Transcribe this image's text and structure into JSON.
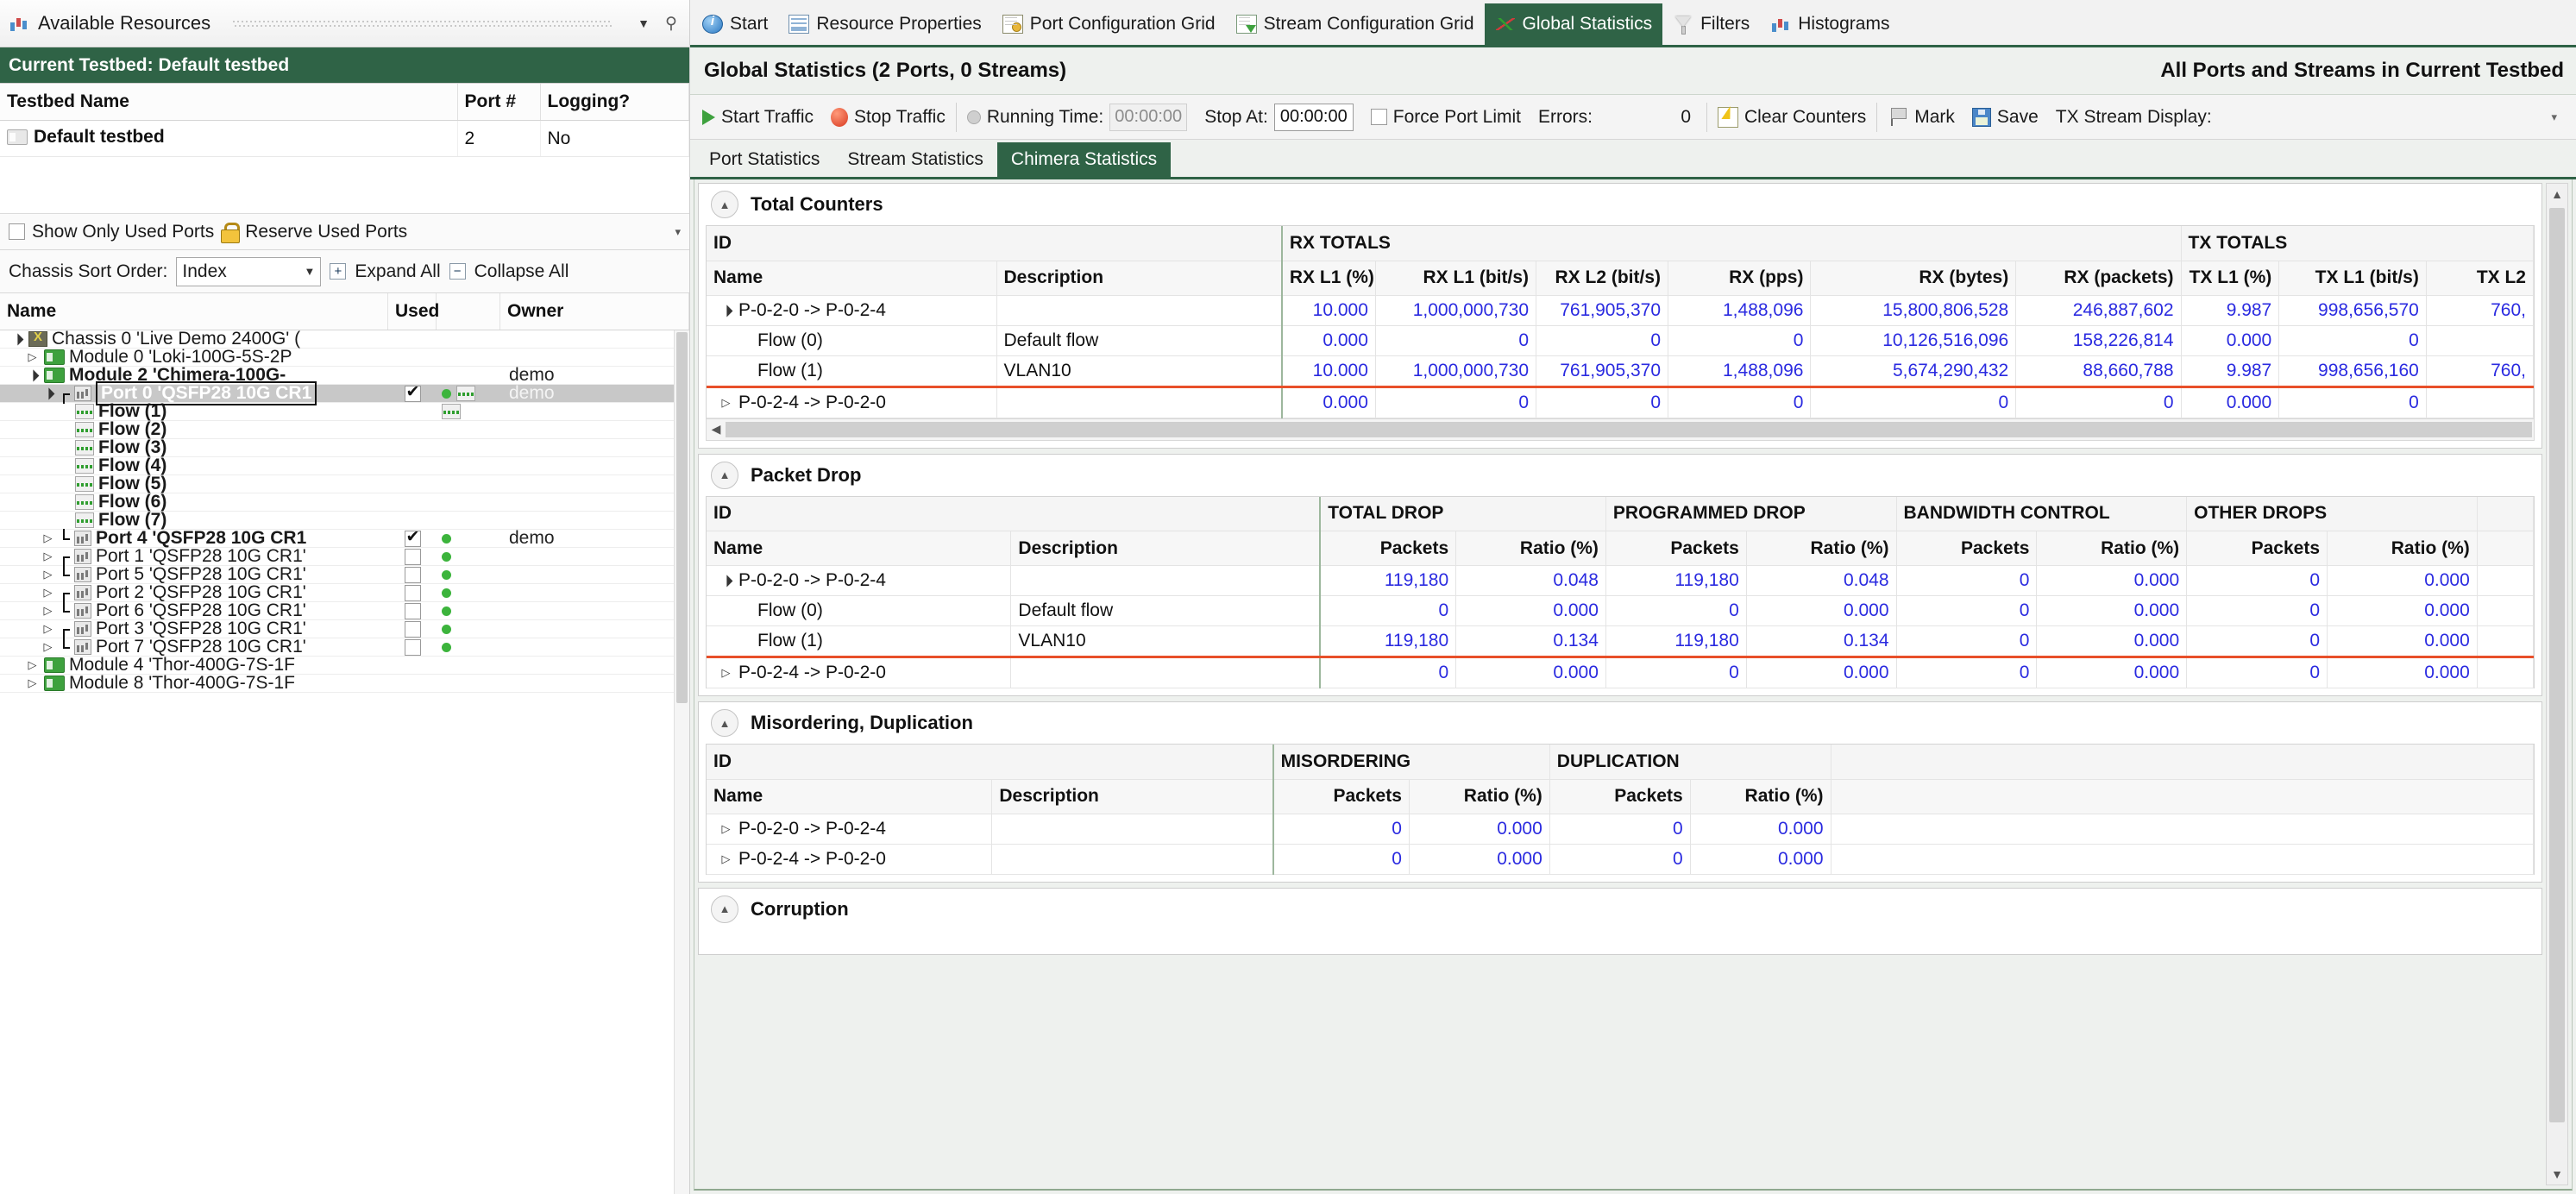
{
  "left_panel": {
    "title": "Available Resources",
    "title_icon": "chart-icon",
    "caret_icon": "chevron-down-icon",
    "pin_icon": "pin-icon",
    "testbed_banner": "Current Testbed: Default testbed",
    "testbed_table": {
      "headers": [
        "Testbed Name",
        "Port #",
        "Logging?"
      ],
      "rows": [
        {
          "name": "Default testbed",
          "ports": "2",
          "logging": "No"
        }
      ]
    },
    "options": {
      "show_only_used_ports": {
        "label": "Show Only Used Ports",
        "checked": false
      },
      "reserve_used_ports": {
        "label": "Reserve Used Ports"
      },
      "overflow_caret": "chevron-down-icon"
    },
    "sort_row": {
      "label": "Chassis Sort Order:",
      "value": "Index",
      "expand_all": "Expand All",
      "collapse_all": "Collapse All"
    },
    "tree_headers": [
      "Name",
      "Used",
      "",
      "Owner"
    ],
    "tree": [
      {
        "label": "Chassis 0 'Live Demo 2400G' (",
        "icon": "chassis-icon",
        "indent": 0,
        "expander": "open",
        "bold": false,
        "used": "",
        "link": false,
        "owner": ""
      },
      {
        "label": "Module 0 'Loki-100G-5S-2P",
        "icon": "module-icon",
        "indent": 1,
        "expander": "closed",
        "bold": false,
        "used": "",
        "link": false,
        "owner": ""
      },
      {
        "label": "Module 2 'Chimera-100G-",
        "icon": "module-icon",
        "indent": 1,
        "expander": "open",
        "bold": true,
        "used": "",
        "link": false,
        "owner": "demo"
      },
      {
        "label": "Port 0 'QSFP28 10G CR1",
        "icon": "port-icon",
        "indent": 2,
        "expander": "open",
        "bold": true,
        "used": "checked",
        "link": true,
        "flowicon": true,
        "owner": "demo",
        "selected": true,
        "bracket": "top"
      },
      {
        "label": "Flow (1)",
        "icon": "flow-icon",
        "indent": 3,
        "expander": "none",
        "bold": true,
        "used": "",
        "link": false,
        "flowicon": true,
        "owner": ""
      },
      {
        "label": "Flow (2)",
        "icon": "flow-icon",
        "indent": 3,
        "expander": "none",
        "bold": true,
        "used": "",
        "link": false,
        "owner": ""
      },
      {
        "label": "Flow (3)",
        "icon": "flow-icon",
        "indent": 3,
        "expander": "none",
        "bold": true,
        "used": "",
        "link": false,
        "owner": ""
      },
      {
        "label": "Flow (4)",
        "icon": "flow-icon",
        "indent": 3,
        "expander": "none",
        "bold": true,
        "used": "",
        "link": false,
        "owner": ""
      },
      {
        "label": "Flow (5)",
        "icon": "flow-icon",
        "indent": 3,
        "expander": "none",
        "bold": true,
        "used": "",
        "link": false,
        "owner": ""
      },
      {
        "label": "Flow (6)",
        "icon": "flow-icon",
        "indent": 3,
        "expander": "none",
        "bold": true,
        "used": "",
        "link": false,
        "owner": ""
      },
      {
        "label": "Flow (7)",
        "icon": "flow-icon",
        "indent": 3,
        "expander": "none",
        "bold": true,
        "used": "",
        "link": false,
        "owner": ""
      },
      {
        "label": "Port 4 'QSFP28 10G CR1",
        "icon": "port-icon",
        "indent": 2,
        "expander": "closed",
        "bold": true,
        "used": "checked",
        "link": true,
        "owner": "demo",
        "bracket": "bot"
      },
      {
        "label": "Port 1 'QSFP28 10G CR1'",
        "icon": "port-icon",
        "indent": 2,
        "expander": "closed",
        "bold": false,
        "used": "unchecked",
        "link": true,
        "owner": "",
        "bracket": "top"
      },
      {
        "label": "Port 5 'QSFP28 10G CR1'",
        "icon": "port-icon",
        "indent": 2,
        "expander": "closed",
        "bold": false,
        "used": "unchecked",
        "link": true,
        "owner": "",
        "bracket": "bot"
      },
      {
        "label": "Port 2 'QSFP28 10G CR1'",
        "icon": "port-icon",
        "indent": 2,
        "expander": "closed",
        "bold": false,
        "used": "unchecked",
        "link": true,
        "owner": "",
        "bracket": "top"
      },
      {
        "label": "Port 6 'QSFP28 10G CR1'",
        "icon": "port-icon",
        "indent": 2,
        "expander": "closed",
        "bold": false,
        "used": "unchecked",
        "link": true,
        "owner": "",
        "bracket": "bot"
      },
      {
        "label": "Port 3 'QSFP28 10G CR1'",
        "icon": "port-icon",
        "indent": 2,
        "expander": "closed",
        "bold": false,
        "used": "unchecked",
        "link": true,
        "owner": "",
        "bracket": "top"
      },
      {
        "label": "Port 7 'QSFP28 10G CR1'",
        "icon": "port-icon",
        "indent": 2,
        "expander": "closed",
        "bold": false,
        "used": "unchecked",
        "link": true,
        "owner": "",
        "bracket": "bot"
      },
      {
        "label": "Module 4 'Thor-400G-7S-1F",
        "icon": "module-icon",
        "indent": 1,
        "expander": "closed",
        "bold": false,
        "used": "",
        "link": false,
        "owner": ""
      },
      {
        "label": "Module 8 'Thor-400G-7S-1F",
        "icon": "module-icon",
        "indent": 1,
        "expander": "closed",
        "bold": false,
        "used": "",
        "link": false,
        "owner": ""
      }
    ]
  },
  "tabs": [
    {
      "label": "Start",
      "icon": "info-circle-icon",
      "active": false
    },
    {
      "label": "Resource Properties",
      "icon": "properties-grid-icon",
      "active": false
    },
    {
      "label": "Port Configuration Grid",
      "icon": "port-grid-icon",
      "active": false
    },
    {
      "label": "Stream Configuration Grid",
      "icon": "stream-grid-icon",
      "active": false
    },
    {
      "label": "Global Statistics",
      "icon": "statistics-icon",
      "active": true
    },
    {
      "label": "Filters",
      "icon": "filter-icon",
      "active": false
    },
    {
      "label": "Histograms",
      "icon": "histogram-icon",
      "active": false
    }
  ],
  "panel": {
    "title": "Global Statistics (2 Ports, 0 Streams)",
    "scope_label": "All Ports and Streams in Current Testbed"
  },
  "toolbar": {
    "start_traffic": "Start Traffic",
    "stop_traffic": "Stop Traffic",
    "running_time_label": "Running Time:",
    "running_time_value": "00:00:00",
    "stop_at_label": "Stop At:",
    "stop_at_value": "00:00:00",
    "force_port_limit": "Force Port Limit",
    "force_port_limit_checked": false,
    "errors_label": "Errors:",
    "errors_value": "0",
    "clear_counters": "Clear Counters",
    "mark": "Mark",
    "save": "Save",
    "tx_stream_display_label": "TX Stream Display:",
    "tx_stream_display_value": ""
  },
  "subtabs": [
    {
      "label": "Port Statistics",
      "active": false
    },
    {
      "label": "Stream Statistics",
      "active": false
    },
    {
      "label": "Chimera Statistics",
      "active": true
    }
  ],
  "sections": {
    "total_counters": {
      "title": "Total Counters",
      "group_headers": [
        {
          "label": "ID",
          "span": 2
        },
        {
          "label": "RX TOTALS",
          "span": 6
        },
        {
          "label": "TX TOTALS",
          "span": 3
        }
      ],
      "columns": [
        "Name",
        "Description",
        "RX L1 (%)",
        "RX L1 (bit/s)",
        "RX L2 (bit/s)",
        "RX (pps)",
        "RX (bytes)",
        "RX (packets)",
        "TX L1 (%)",
        "TX L1 (bit/s)",
        "TX L2"
      ],
      "rows": [
        {
          "expander": "open",
          "indent": 0,
          "name": "P-0-2-0 -> P-0-2-4",
          "description": "",
          "values": [
            "10.000",
            "1,000,000,730",
            "761,905,370",
            "1,488,096",
            "15,800,806,528",
            "246,887,602",
            "9.987",
            "998,656,570",
            "760,"
          ]
        },
        {
          "expander": "none",
          "indent": 1,
          "name": "Flow (0)",
          "description": "Default flow",
          "values": [
            "0.000",
            "0",
            "0",
            "0",
            "10,126,516,096",
            "158,226,814",
            "0.000",
            "0",
            ""
          ]
        },
        {
          "expander": "none",
          "indent": 1,
          "name": "Flow (1)",
          "description": "VLAN10",
          "redline": true,
          "values": [
            "10.000",
            "1,000,000,730",
            "761,905,370",
            "1,488,096",
            "5,674,290,432",
            "88,660,788",
            "9.987",
            "998,656,160",
            "760,"
          ]
        },
        {
          "expander": "closed",
          "indent": 0,
          "name": "P-0-2-4 -> P-0-2-0",
          "description": "",
          "values": [
            "0.000",
            "0",
            "0",
            "0",
            "0",
            "0",
            "0.000",
            "0",
            ""
          ]
        }
      ],
      "hscroll_left_arrow": "left-arrow-icon",
      "hscroll_right_arrow": "right-arrow-icon"
    },
    "packet_drop": {
      "title": "Packet Drop",
      "group_headers": [
        {
          "label": "ID",
          "span": 2
        },
        {
          "label": "TOTAL DROP",
          "span": 2
        },
        {
          "label": "PROGRAMMED DROP",
          "span": 2
        },
        {
          "label": "BANDWIDTH CONTROL",
          "span": 2
        },
        {
          "label": "OTHER DROPS",
          "span": 2
        },
        {
          "label": "",
          "span": 1
        }
      ],
      "columns": [
        "Name",
        "Description",
        "Packets",
        "Ratio (%)",
        "Packets",
        "Ratio (%)",
        "Packets",
        "Ratio (%)",
        "Packets",
        "Ratio (%)",
        ""
      ],
      "rows": [
        {
          "expander": "open",
          "indent": 0,
          "name": "P-0-2-0 -> P-0-2-4",
          "description": "",
          "values": [
            "119,180",
            "0.048",
            "119,180",
            "0.048",
            "0",
            "0.000",
            "0",
            "0.000",
            ""
          ]
        },
        {
          "expander": "none",
          "indent": 1,
          "name": "Flow (0)",
          "description": "Default flow",
          "values": [
            "0",
            "0.000",
            "0",
            "0.000",
            "0",
            "0.000",
            "0",
            "0.000",
            ""
          ]
        },
        {
          "expander": "none",
          "indent": 1,
          "name": "Flow (1)",
          "description": "VLAN10",
          "redline": true,
          "values": [
            "119,180",
            "0.134",
            "119,180",
            "0.134",
            "0",
            "0.000",
            "0",
            "0.000",
            ""
          ]
        },
        {
          "expander": "closed",
          "indent": 0,
          "name": "P-0-2-4 -> P-0-2-0",
          "description": "",
          "values": [
            "0",
            "0.000",
            "0",
            "0.000",
            "0",
            "0.000",
            "0",
            "0.000",
            ""
          ]
        }
      ]
    },
    "misordering": {
      "title": "Misordering, Duplication",
      "group_headers": [
        {
          "label": "ID",
          "span": 2
        },
        {
          "label": "MISORDERING",
          "span": 2
        },
        {
          "label": "DUPLICATION",
          "span": 2
        },
        {
          "label": "",
          "span": 1
        }
      ],
      "columns": [
        "Name",
        "Description",
        "Packets",
        "Ratio (%)",
        "Packets",
        "Ratio (%)",
        ""
      ],
      "rows": [
        {
          "expander": "closed",
          "indent": 0,
          "name": "P-0-2-0 -> P-0-2-4",
          "description": "",
          "values": [
            "0",
            "0.000",
            "0",
            "0.000",
            ""
          ]
        },
        {
          "expander": "closed",
          "indent": 0,
          "name": "P-0-2-4 -> P-0-2-0",
          "description": "",
          "values": [
            "0",
            "0.000",
            "0",
            "0.000",
            ""
          ]
        }
      ]
    },
    "corruption": {
      "title": "Corruption"
    }
  },
  "colors": {
    "accent_green": "#2f6346",
    "value_blue": "#2a2ae0",
    "red_marker": "#e8502a"
  }
}
